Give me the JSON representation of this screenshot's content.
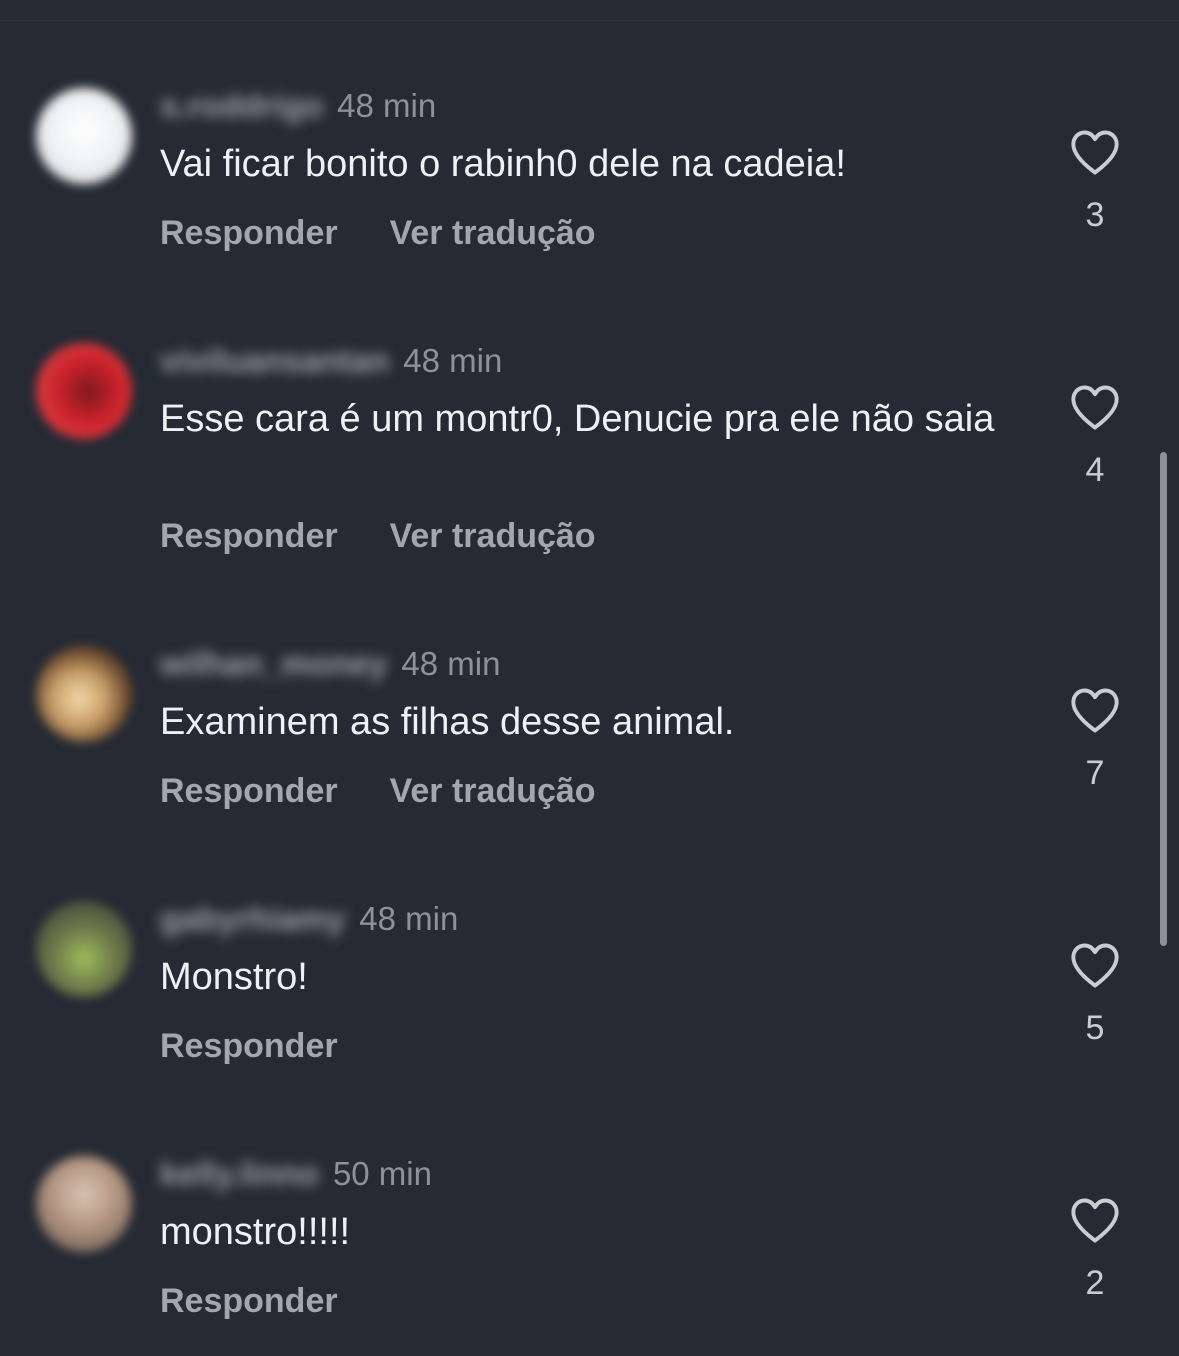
{
  "comments": [
    {
      "username": "s.roddrigo",
      "time": "48 min",
      "text": "Vai ficar bonito o rabinh0 dele na cadeia!",
      "reply_label": "Responder",
      "translate_label": "Ver tradução",
      "likes": "3",
      "avatar_color": "#e8e9ec"
    },
    {
      "username": "viviluansantan",
      "time": "48 min",
      "text": "Esse cara é um montr0, Denucie pra ele não saia",
      "reply_label": "Responder",
      "translate_label": "Ver tradução",
      "likes": "4",
      "avatar_color": "#c8202a"
    },
    {
      "username": "wilhan_money",
      "time": "48 min",
      "text": "Examinem as filhas desse animal.",
      "reply_label": "Responder",
      "translate_label": "Ver tradução",
      "likes": "7",
      "avatar_color": "#6b4a2e"
    },
    {
      "username": "gabyrhiamy",
      "time": "48 min",
      "text": "Monstro!",
      "reply_label": "Responder",
      "likes": "5",
      "avatar_color": "#6f7a4a"
    },
    {
      "username": "kelly.linno",
      "time": "50 min",
      "text": "monstro!!!!!",
      "reply_label": "Responder",
      "likes": "2",
      "avatar_color": "#b79a86"
    }
  ]
}
